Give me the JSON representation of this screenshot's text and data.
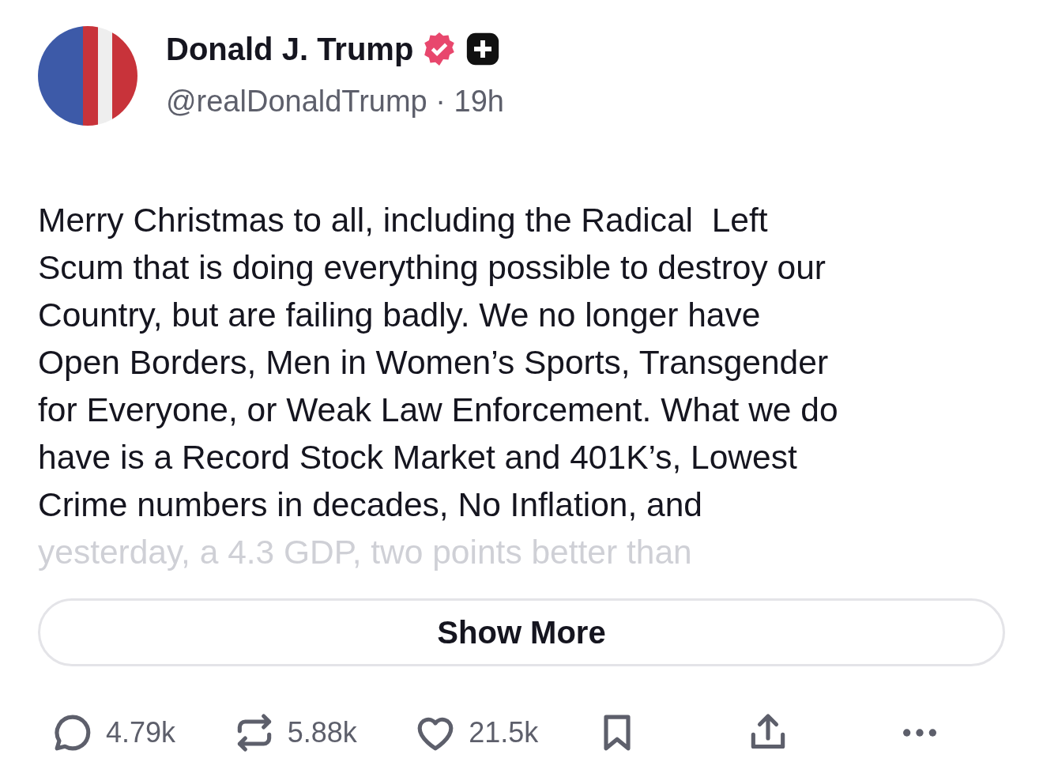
{
  "post": {
    "author": {
      "name": "Donald J. Trump",
      "verified": true,
      "handle": "@realDonaldTrump",
      "separator": "·",
      "time": "19h"
    },
    "body_lines": [
      "Merry Christmas to all, including the Radical  Left",
      "Scum that is doing everything possible to destroy our",
      "Country, but are failing badly. We no longer have",
      "Open Borders, Men in Women’s Sports, Transgender",
      "for Everyone, or Weak Law Enforcement. What we do",
      "have is a Record Stock Market and 401K’s, Lowest",
      "Crime numbers in decades, No Inflation, and",
      "yesterday, a 4.3 GDP, two points better than"
    ],
    "show_more": "Show More",
    "actions": [
      {
        "kind": "reply",
        "count": "4.79k"
      },
      {
        "kind": "repost",
        "count": "5.88k"
      },
      {
        "kind": "like",
        "count": "21.5k"
      },
      {
        "kind": "bookmark"
      },
      {
        "kind": "share"
      },
      {
        "kind": "more"
      }
    ]
  }
}
